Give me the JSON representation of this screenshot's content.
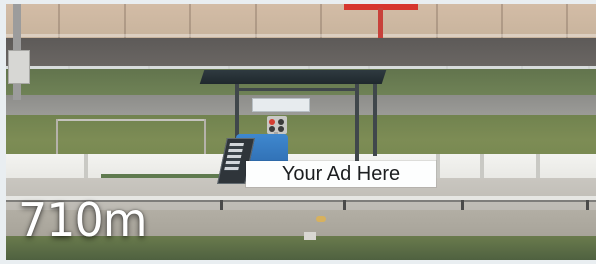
{
  "scene": {
    "ad_text": "Your Ad Here",
    "distance_label": "710m"
  },
  "colors": {
    "ad_background": "#fdfefe",
    "ad_text": "#1c1e20",
    "distance_text": "#ffffff",
    "booth_blue": "#3f88cf",
    "wall_sign_red": "#d6362e"
  }
}
